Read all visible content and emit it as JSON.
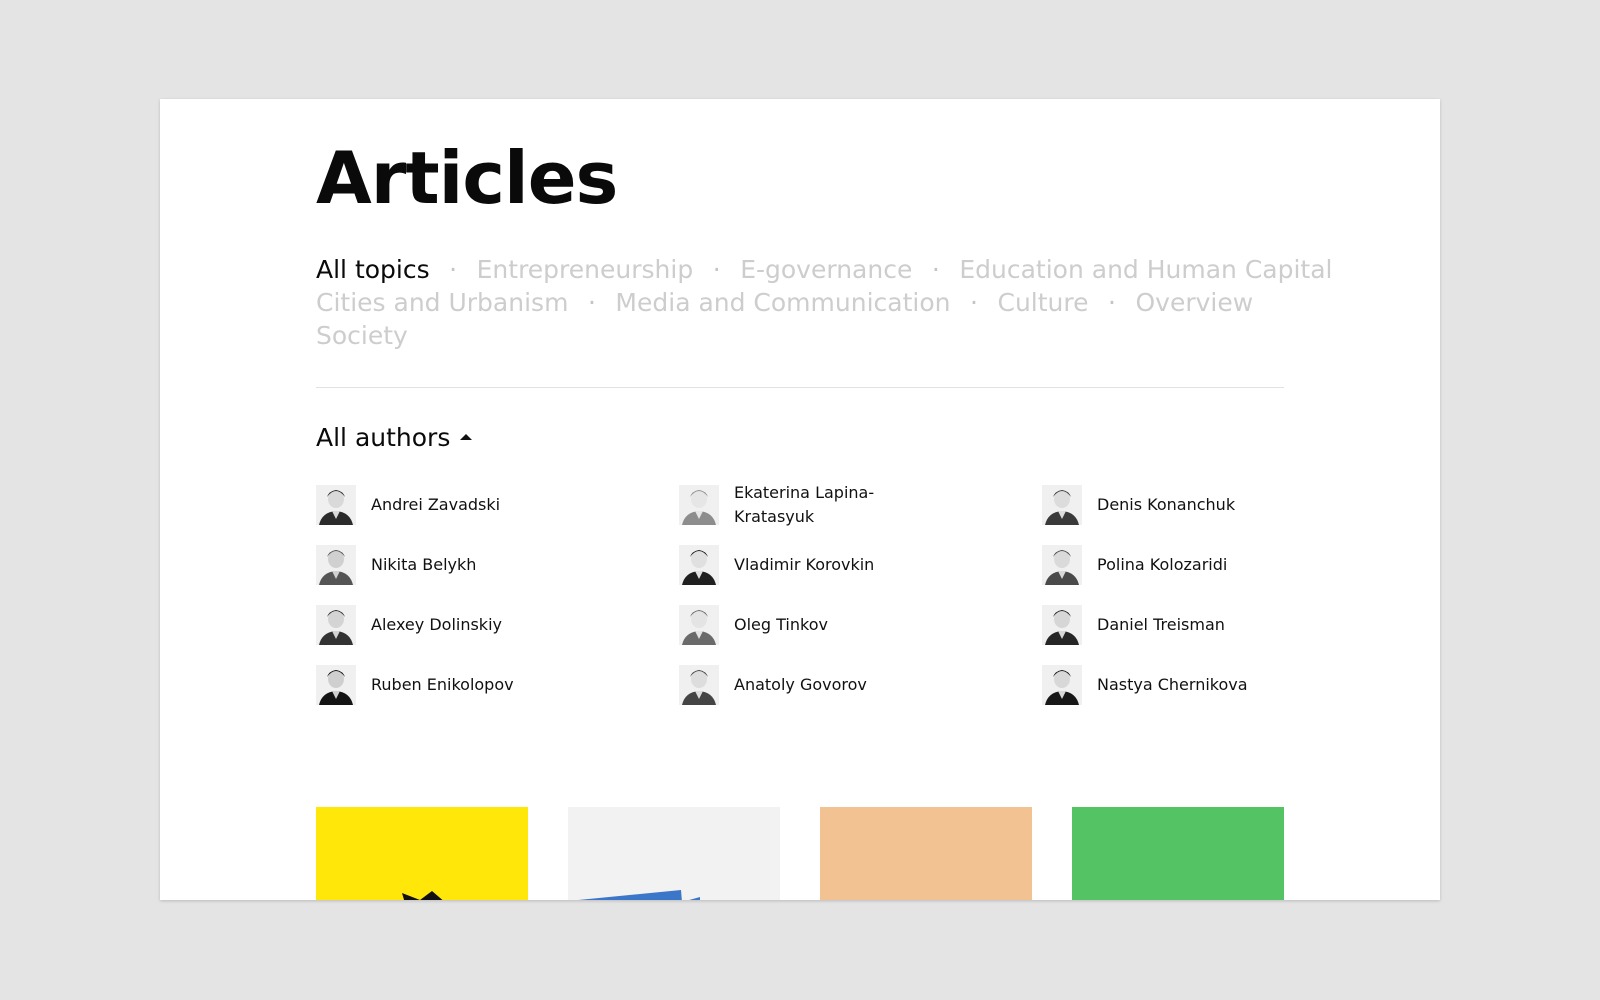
{
  "page": {
    "title": "Articles"
  },
  "topics": {
    "rows": [
      [
        {
          "label": "All topics",
          "active": true
        },
        {
          "label": "Entrepreneurship",
          "active": false
        },
        {
          "label": "E-governance",
          "active": false
        },
        {
          "label": "Education and Human Capital",
          "active": false
        }
      ],
      [
        {
          "label": "Cities and Urbanism",
          "active": false
        },
        {
          "label": "Media and Communication",
          "active": false
        },
        {
          "label": "Culture",
          "active": false
        },
        {
          "label": "Overview",
          "active": false
        }
      ],
      [
        {
          "label": "Society",
          "active": false
        }
      ]
    ],
    "separator": "·"
  },
  "authors": {
    "toggle_label": "All authors",
    "toggle_icon": "caret-up-icon",
    "items": [
      {
        "name": "Andrei Zavadski",
        "avatar_icon": "portrait-icon"
      },
      {
        "name": "Ekaterina Lapina-Kratasyuk",
        "avatar_icon": "portrait-icon"
      },
      {
        "name": "Denis Konanchuk",
        "avatar_icon": "portrait-icon"
      },
      {
        "name": "Nikita Belykh",
        "avatar_icon": "portrait-icon"
      },
      {
        "name": "Vladimir Korovkin",
        "avatar_icon": "portrait-icon"
      },
      {
        "name": "Polina Kolozaridi",
        "avatar_icon": "portrait-icon"
      },
      {
        "name": "Alexey Dolinskiy",
        "avatar_icon": "portrait-icon"
      },
      {
        "name": "Oleg Tinkov",
        "avatar_icon": "portrait-icon"
      },
      {
        "name": "Daniel Treisman",
        "avatar_icon": "portrait-icon"
      },
      {
        "name": "Ruben Enikolopov",
        "avatar_icon": "portrait-icon"
      },
      {
        "name": "Anatoly Govorov",
        "avatar_icon": "portrait-icon"
      },
      {
        "name": "Nastya Chernikova",
        "avatar_icon": "portrait-icon"
      }
    ]
  },
  "cards": [
    {
      "color": "#ffe70a",
      "illustration_color": "#111111",
      "icon": "bird-illustration-icon"
    },
    {
      "color": "#f2f2f2",
      "illustration_color": "#3b76c9",
      "icon": "paper-illustration-icon"
    },
    {
      "color": "#f3c292",
      "illustration_color": "",
      "icon": ""
    },
    {
      "color": "#54c363",
      "illustration_color": "",
      "icon": ""
    }
  ],
  "colors": {
    "background": "#e4e4e4",
    "page": "#ffffff",
    "text": "#0a0a0a",
    "muted_text": "#cdcdcd",
    "divider": "#e2e2e2"
  }
}
